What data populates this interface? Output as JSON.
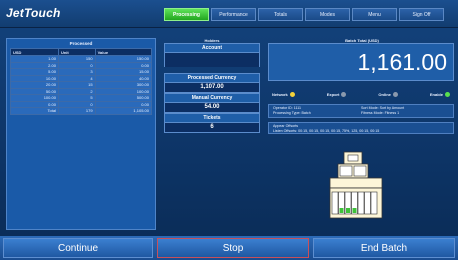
{
  "app": {
    "title": "JetTouch"
  },
  "tabs": [
    {
      "label": "Processing",
      "active": true
    },
    {
      "label": "Performance",
      "active": false
    },
    {
      "label": "Totals",
      "active": false
    },
    {
      "label": "Modes",
      "active": false
    },
    {
      "label": "Menu",
      "active": false
    },
    {
      "label": "Sign Off",
      "active": false
    }
  ],
  "processed_panel": {
    "title": "Processed",
    "columns": [
      "USD",
      "Unit",
      "Value"
    ],
    "rows": [
      [
        "1.00",
        "150",
        "150.00"
      ],
      [
        "2.00",
        "0",
        "0.00"
      ],
      [
        "5.00",
        "3",
        "15.00"
      ],
      [
        "10.00",
        "4",
        "40.00"
      ],
      [
        "20.00",
        "15",
        "300.00"
      ],
      [
        "50.00",
        "2",
        "100.00"
      ],
      [
        "100.00",
        "5",
        "500.00"
      ],
      [
        "0.00",
        "0",
        "0.00"
      ],
      [
        "Total",
        "179",
        "1,105.00"
      ]
    ]
  },
  "middle_panel": {
    "title": "Holders",
    "account_label": "Account",
    "account_value": "",
    "processed_currency_label": "Processed Currency",
    "processed_currency_value": "1,107.00",
    "manual_currency_label": "Manual Currency",
    "manual_currency_value": "54.00",
    "tickets_label": "Tickets",
    "tickets_value": "6"
  },
  "batch_panel": {
    "title": "Batch Total (USD)",
    "total": "1,161.00",
    "status": [
      {
        "label": "Network",
        "color": "yellow"
      },
      {
        "label": "Export",
        "color": "gray"
      },
      {
        "label": "Online",
        "color": "gray"
      },
      {
        "label": "Enable",
        "color": "green"
      }
    ],
    "info_left": [
      "Operator ID: 1111",
      "Processing Type: Batch"
    ],
    "info_right": [
      "Sort Mode: Sort by Amount",
      "Fitness Mode: Fitness 1"
    ],
    "info_bottom": [
      "Appear Offsorts",
      "Listen Offsorts: 00:15, 00:15, 00:15, 00:15, 75%, 125, 00:15, 00:15"
    ]
  },
  "bottom_bar": {
    "continue_label": "Continue",
    "stop_label": "Stop",
    "end_batch_label": "End Batch"
  },
  "colors": {
    "accent_green": "#22a61f",
    "background_blue": "#0d3466",
    "stop_border": "#c8505a"
  }
}
